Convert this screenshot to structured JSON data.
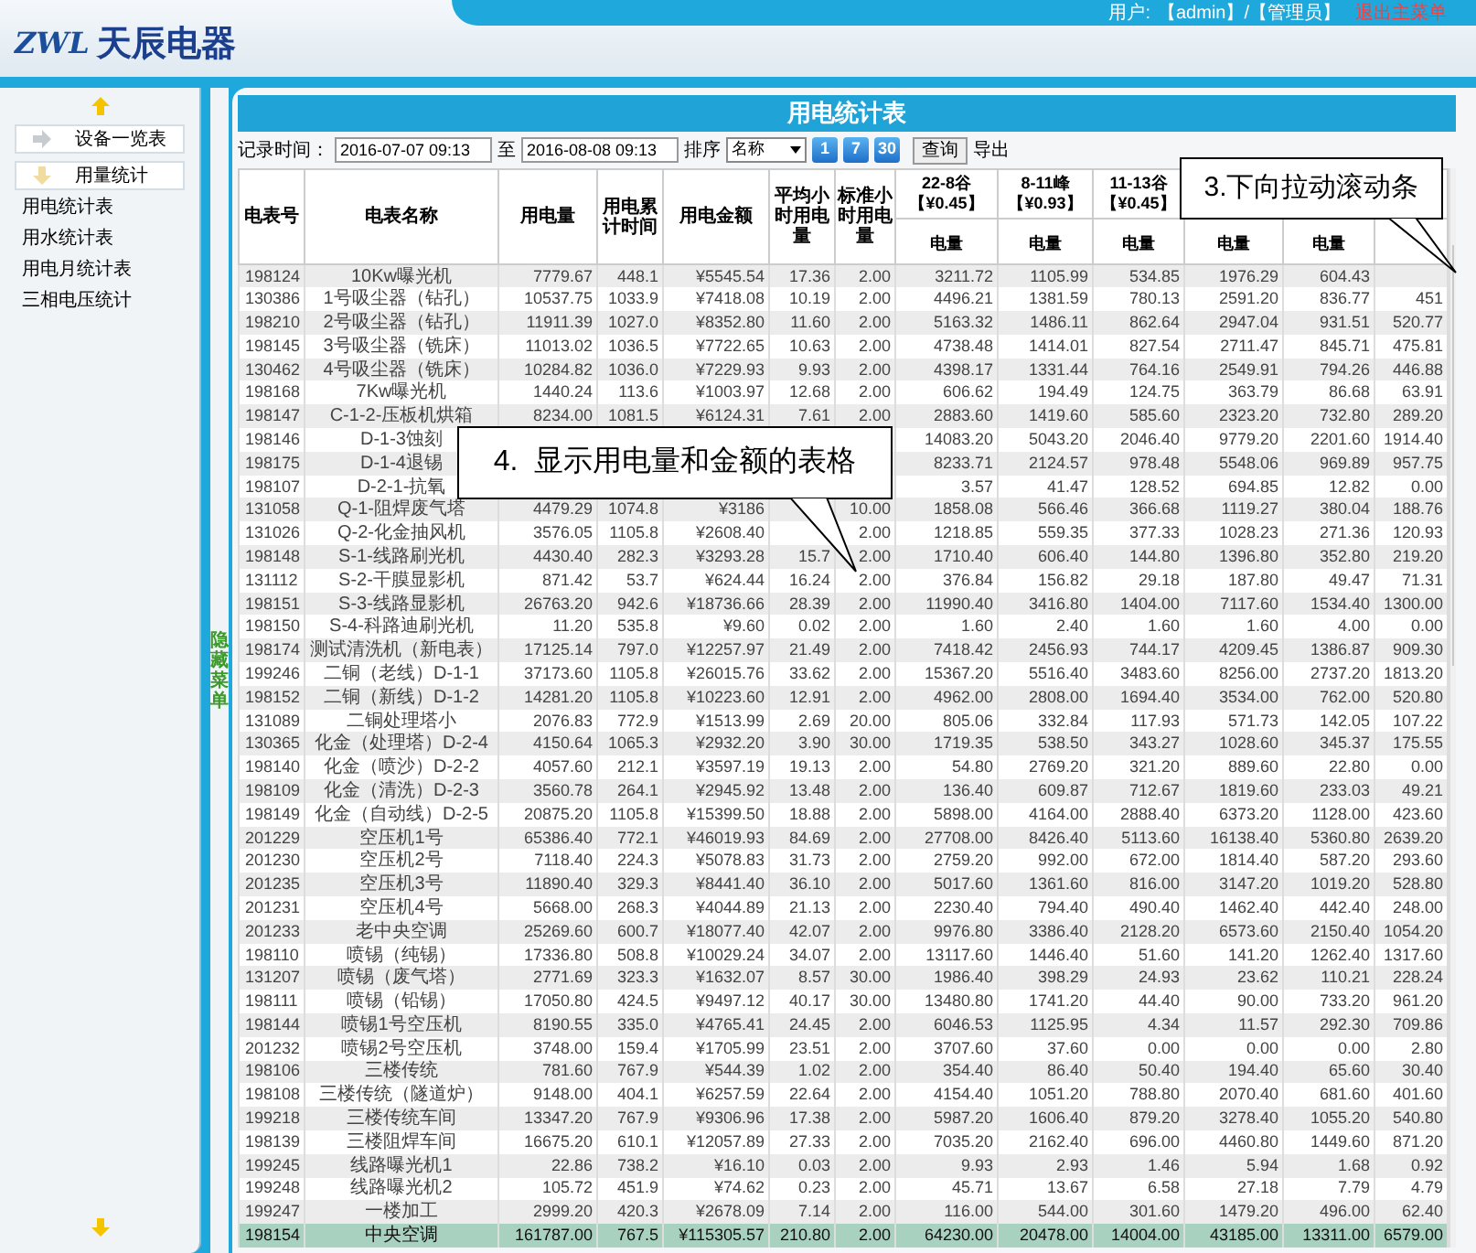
{
  "header": {
    "logo_mark": "ZWL",
    "brand": "天辰电器",
    "user_label": "用户:",
    "user": "【admin】/【管理员】",
    "logout": "退出主菜单"
  },
  "sidebar": {
    "items": [
      {
        "label": "设备一览表",
        "expanded": false
      },
      {
        "label": "用量统计",
        "expanded": true,
        "children": [
          {
            "label": "用电统计表"
          },
          {
            "label": "用水统计表"
          },
          {
            "label": "用电月统计表"
          },
          {
            "label": "三相电压统计"
          }
        ]
      }
    ],
    "toggle": "隐藏菜单"
  },
  "panel": {
    "title": "用电统计表",
    "filter": {
      "label": "记录时间：",
      "start": "2016-07-07 09:13",
      "separator": "至",
      "end": "2016-08-08 09:13",
      "sort_label": "排序",
      "sort_value": "名称",
      "ranges": [
        "1",
        "7",
        "30"
      ],
      "query": "查询",
      "export": "导出"
    },
    "columns": [
      {
        "label": "电表号"
      },
      {
        "label": "电表名称"
      },
      {
        "label": "用电量"
      },
      {
        "label": "用电累计时间"
      },
      {
        "label": "用电金额"
      },
      {
        "label": "平均小时用电量"
      },
      {
        "label": "标准小时用电量"
      },
      {
        "label": "22-8谷",
        "price": "【¥0.45】",
        "sub": "电量"
      },
      {
        "label": "8-11峰",
        "price": "【¥0.93】",
        "sub": "电量"
      },
      {
        "label": "11-13谷",
        "price": "【¥0.45】",
        "sub": "电量"
      },
      {
        "sub": "电量"
      },
      {
        "sub": "电量"
      }
    ],
    "rows": [
      {
        "selected": false,
        "cells": [
          "198124",
          "10Kw曝光机",
          "7779.67",
          "448.1",
          "¥5545.54",
          "17.36",
          "2.00",
          "3211.72",
          "1105.99",
          "534.85",
          "1976.29",
          "604.43",
          null
        ]
      },
      {
        "selected": false,
        "cells": [
          "130386",
          "1号吸尘器（钻孔）",
          "10537.75",
          "1033.9",
          "¥7418.08",
          "10.19",
          "2.00",
          "4496.21",
          "1381.59",
          "780.13",
          "2591.20",
          "836.77",
          "451"
        ]
      },
      {
        "selected": false,
        "cells": [
          "198210",
          "2号吸尘器（钻孔）",
          "11911.39",
          "1027.0",
          "¥8352.80",
          "11.60",
          "2.00",
          "5163.32",
          "1486.11",
          "862.64",
          "2947.04",
          "931.51",
          "520.77"
        ]
      },
      {
        "selected": false,
        "cells": [
          "198145",
          "3号吸尘器（铣床）",
          "11013.02",
          "1036.5",
          "¥7722.65",
          "10.63",
          "2.00",
          "4738.48",
          "1414.01",
          "827.54",
          "2711.47",
          "845.71",
          "475.81"
        ]
      },
      {
        "selected": false,
        "cells": [
          "130462",
          "4号吸尘器（铣床）",
          "10284.82",
          "1036.0",
          "¥7229.93",
          "9.93",
          "2.00",
          "4398.17",
          "1331.44",
          "764.16",
          "2549.91",
          "794.26",
          "446.88"
        ]
      },
      {
        "selected": false,
        "cells": [
          "198168",
          "7Kw曝光机",
          "1440.24",
          "113.6",
          "¥1003.97",
          "12.68",
          "2.00",
          "606.62",
          "194.49",
          "124.75",
          "363.79",
          "86.68",
          "63.91"
        ]
      },
      {
        "selected": false,
        "cells": [
          "198147",
          "C-1-2-压板机烘箱",
          "8234.00",
          "1081.5",
          "¥6124.31",
          "7.61",
          "2.00",
          "2883.60",
          "1419.60",
          "585.60",
          "2323.20",
          "732.80",
          "289.20"
        ]
      },
      {
        "selected": false,
        "cells": [
          "198146",
          "D-1-3蚀刻",
          null,
          null,
          null,
          null,
          null,
          "14083.20",
          "5043.20",
          "2046.40",
          "9779.20",
          "2201.60",
          "1914.40"
        ]
      },
      {
        "selected": false,
        "cells": [
          "198175",
          "D-1-4退锡",
          null,
          null,
          null,
          null,
          null,
          "8233.71",
          "2124.57",
          "978.48",
          "5548.06",
          "969.89",
          "957.75"
        ]
      },
      {
        "selected": false,
        "cells": [
          "198107",
          "D-2-1-抗氧",
          null,
          null,
          null,
          null,
          null,
          "3.57",
          "41.47",
          "128.52",
          "694.85",
          "12.82",
          "0.00"
        ]
      },
      {
        "selected": false,
        "cells": [
          "131058",
          "Q-1-阻焊废气塔",
          "4479.29",
          "1074.8",
          "¥3186",
          null,
          "10.00",
          "1858.08",
          "566.46",
          "366.68",
          "1119.27",
          "380.04",
          "188.76"
        ]
      },
      {
        "selected": false,
        "cells": [
          "131026",
          "Q-2-化金抽风机",
          "3576.05",
          "1105.8",
          "¥2608.40",
          null,
          "2.00",
          "1218.85",
          "559.35",
          "377.33",
          "1028.23",
          "271.36",
          "120.93"
        ]
      },
      {
        "selected": false,
        "cells": [
          "198148",
          "S-1-线路刷光机",
          "4430.40",
          "282.3",
          "¥3293.28",
          "15.7",
          "2.00",
          "1710.40",
          "606.40",
          "144.80",
          "1396.80",
          "352.80",
          "219.20"
        ]
      },
      {
        "selected": false,
        "cells": [
          "131112",
          "S-2-干膜显影机",
          "871.42",
          "53.7",
          "¥624.44",
          "16.24",
          "2.00",
          "376.84",
          "156.82",
          "29.18",
          "187.80",
          "49.47",
          "71.31"
        ]
      },
      {
        "selected": false,
        "cells": [
          "198151",
          "S-3-线路显影机",
          "26763.20",
          "942.6",
          "¥18736.66",
          "28.39",
          "2.00",
          "11990.40",
          "3416.80",
          "1404.00",
          "7117.60",
          "1534.40",
          "1300.00"
        ]
      },
      {
        "selected": false,
        "cells": [
          "198150",
          "S-4-科路迪刷光机",
          "11.20",
          "535.8",
          "¥9.60",
          "0.02",
          "2.00",
          "1.60",
          "2.40",
          "1.60",
          "1.60",
          "4.00",
          "0.00"
        ]
      },
      {
        "selected": false,
        "cells": [
          "198174",
          "测试清洗机（新电表）",
          "17125.14",
          "797.0",
          "¥12257.97",
          "21.49",
          "2.00",
          "7418.42",
          "2456.93",
          "744.17",
          "4209.45",
          "1386.87",
          "909.30"
        ]
      },
      {
        "selected": false,
        "cells": [
          "199246",
          "二铜（老线）D-1-1",
          "37173.60",
          "1105.8",
          "¥26015.76",
          "33.62",
          "2.00",
          "15367.20",
          "5516.40",
          "3483.60",
          "8256.00",
          "2737.20",
          "1813.20"
        ]
      },
      {
        "selected": false,
        "cells": [
          "198152",
          "二铜（新线）D-1-2",
          "14281.20",
          "1105.8",
          "¥10223.60",
          "12.91",
          "2.00",
          "4962.00",
          "2808.00",
          "1694.40",
          "3534.00",
          "762.00",
          "520.80"
        ]
      },
      {
        "selected": false,
        "cells": [
          "131089",
          "二铜处理塔小",
          "2076.83",
          "772.9",
          "¥1513.99",
          "2.69",
          "20.00",
          "805.06",
          "332.84",
          "117.93",
          "571.73",
          "142.05",
          "107.22"
        ]
      },
      {
        "selected": false,
        "cells": [
          "130365",
          "化金（处理塔）D-2-4",
          "4150.64",
          "1065.3",
          "¥2932.20",
          "3.90",
          "30.00",
          "1719.35",
          "538.50",
          "343.27",
          "1028.60",
          "345.37",
          "175.55"
        ]
      },
      {
        "selected": false,
        "cells": [
          "198140",
          "化金（喷沙）D-2-2",
          "4057.60",
          "212.1",
          "¥3597.19",
          "19.13",
          "2.00",
          "54.80",
          "2769.20",
          "321.20",
          "889.60",
          "22.80",
          "0.00"
        ]
      },
      {
        "selected": false,
        "cells": [
          "198109",
          "化金（清洗）D-2-3",
          "3560.78",
          "264.1",
          "¥2945.92",
          "13.48",
          "2.00",
          "136.40",
          "609.87",
          "712.67",
          "1819.60",
          "233.03",
          "49.21"
        ]
      },
      {
        "selected": false,
        "cells": [
          "198149",
          "化金（自动线）D-2-5",
          "20875.20",
          "1105.8",
          "¥15399.50",
          "18.88",
          "2.00",
          "5898.00",
          "4164.00",
          "2888.40",
          "6373.20",
          "1128.00",
          "423.60"
        ]
      },
      {
        "selected": false,
        "cells": [
          "201229",
          "空压机1号",
          "65386.40",
          "772.1",
          "¥46019.93",
          "84.69",
          "2.00",
          "27708.00",
          "8426.40",
          "5113.60",
          "16138.40",
          "5360.80",
          "2639.20"
        ]
      },
      {
        "selected": false,
        "cells": [
          "201230",
          "空压机2号",
          "7118.40",
          "224.3",
          "¥5078.83",
          "31.73",
          "2.00",
          "2759.20",
          "992.00",
          "672.00",
          "1814.40",
          "587.20",
          "293.60"
        ]
      },
      {
        "selected": false,
        "cells": [
          "201235",
          "空压机3号",
          "11890.40",
          "329.3",
          "¥8441.40",
          "36.10",
          "2.00",
          "5017.60",
          "1361.60",
          "816.00",
          "3147.20",
          "1019.20",
          "528.80"
        ]
      },
      {
        "selected": false,
        "cells": [
          "201231",
          "空压机4号",
          "5668.00",
          "268.3",
          "¥4044.89",
          "21.13",
          "2.00",
          "2230.40",
          "794.40",
          "490.40",
          "1462.40",
          "442.40",
          "248.00"
        ]
      },
      {
        "selected": false,
        "cells": [
          "201233",
          "老中央空调",
          "25269.60",
          "600.7",
          "¥18077.40",
          "42.07",
          "2.00",
          "9976.80",
          "3386.40",
          "2128.20",
          "6573.60",
          "2150.40",
          "1054.20"
        ]
      },
      {
        "selected": false,
        "cells": [
          "198110",
          "喷锡（纯锡）",
          "17336.80",
          "508.8",
          "¥10029.24",
          "34.07",
          "2.00",
          "13117.60",
          "1446.40",
          "51.60",
          "141.20",
          "1262.40",
          "1317.60"
        ]
      },
      {
        "selected": false,
        "cells": [
          "131207",
          "喷锡（废气塔）",
          "2771.69",
          "323.3",
          "¥1632.07",
          "8.57",
          "30.00",
          "1986.40",
          "398.29",
          "24.93",
          "23.62",
          "110.21",
          "228.24"
        ]
      },
      {
        "selected": false,
        "cells": [
          "198111",
          "喷锡（铅锡）",
          "17050.80",
          "424.5",
          "¥9497.12",
          "40.17",
          "30.00",
          "13480.80",
          "1741.20",
          "44.40",
          "90.00",
          "733.20",
          "961.20"
        ]
      },
      {
        "selected": false,
        "cells": [
          "198144",
          "喷锡1号空压机",
          "8190.55",
          "335.0",
          "¥4765.41",
          "24.45",
          "2.00",
          "6046.53",
          "1125.95",
          "4.34",
          "11.57",
          "292.30",
          "709.86"
        ]
      },
      {
        "selected": false,
        "cells": [
          "201232",
          "喷锡2号空压机",
          "3748.00",
          "159.4",
          "¥1705.99",
          "23.51",
          "2.00",
          "3707.60",
          "37.60",
          "0.00",
          "0.00",
          "0.00",
          "2.80"
        ]
      },
      {
        "selected": false,
        "cells": [
          "198106",
          "三楼传统",
          "781.60",
          "767.9",
          "¥544.39",
          "1.02",
          "2.00",
          "354.40",
          "86.40",
          "50.40",
          "194.40",
          "65.60",
          "30.40"
        ]
      },
      {
        "selected": false,
        "cells": [
          "198108",
          "三楼传统（隧道炉）",
          "9148.00",
          "404.1",
          "¥6257.59",
          "22.64",
          "2.00",
          "4154.40",
          "1051.20",
          "788.80",
          "2070.40",
          "681.60",
          "401.60"
        ]
      },
      {
        "selected": false,
        "cells": [
          "199218",
          "三楼传统车间",
          "13347.20",
          "767.9",
          "¥9306.96",
          "17.38",
          "2.00",
          "5987.20",
          "1606.40",
          "879.20",
          "3278.40",
          "1055.20",
          "540.80"
        ]
      },
      {
        "selected": false,
        "cells": [
          "198139",
          "三楼阻焊车间",
          "16675.20",
          "610.1",
          "¥12057.89",
          "27.33",
          "2.00",
          "7035.20",
          "2162.40",
          "696.00",
          "4460.80",
          "1449.60",
          "871.20"
        ]
      },
      {
        "selected": false,
        "cells": [
          "199245",
          "线路曝光机1",
          "22.86",
          "738.2",
          "¥16.10",
          "0.03",
          "2.00",
          "9.93",
          "2.93",
          "1.46",
          "5.94",
          "1.68",
          "0.92"
        ]
      },
      {
        "selected": false,
        "cells": [
          "199248",
          "线路曝光机2",
          "105.72",
          "451.9",
          "¥74.62",
          "0.23",
          "2.00",
          "45.71",
          "13.67",
          "6.58",
          "27.18",
          "7.79",
          "4.79"
        ]
      },
      {
        "selected": false,
        "cells": [
          "199247",
          "一楼加工",
          "2999.20",
          "420.3",
          "¥2678.09",
          "7.14",
          "2.00",
          "116.00",
          "544.00",
          "301.60",
          "1479.20",
          "496.00",
          "62.40"
        ]
      },
      {
        "selected": true,
        "cells": [
          "198154",
          "中央空调",
          "161787.00",
          "767.5",
          "¥115305.57",
          "210.80",
          "2.00",
          "64230.00",
          "20478.00",
          "14004.00",
          "43185.00",
          "13311.00",
          "6579.00"
        ]
      }
    ]
  },
  "callouts": [
    {
      "kind": "scroll",
      "text": "3.下向拉动滚动条"
    },
    {
      "kind": "table",
      "text": "4.  显示用电量和金额的表格"
    }
  ]
}
